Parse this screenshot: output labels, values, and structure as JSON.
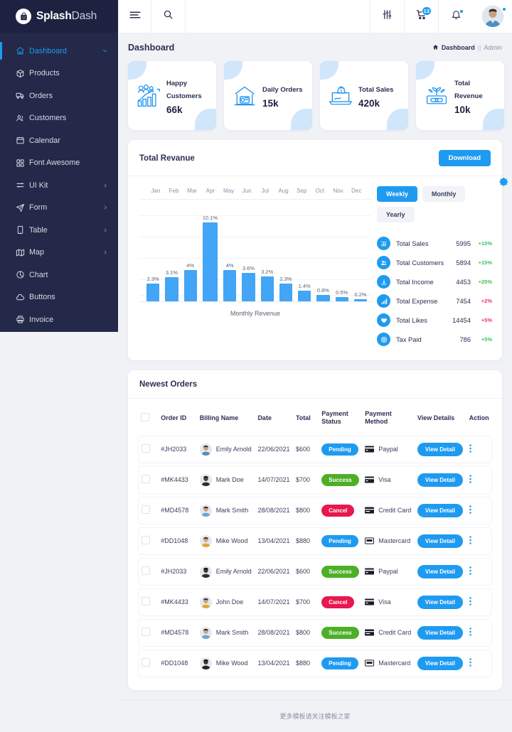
{
  "brand": {
    "part1": "Splash",
    "part2": "Dash",
    "logo_icon": "shopping-bag-icon"
  },
  "sidebar": {
    "items": [
      {
        "label": "Dashboard",
        "icon": "home-icon",
        "active": true,
        "chevron": true
      },
      {
        "label": "Products",
        "icon": "box-icon",
        "active": false,
        "chevron": false
      },
      {
        "label": "Orders",
        "icon": "truck-icon",
        "active": false,
        "chevron": false
      },
      {
        "label": "Customers",
        "icon": "users-icon",
        "active": false,
        "chevron": false
      },
      {
        "label": "Calendar",
        "icon": "calendar-icon",
        "active": false,
        "chevron": false
      },
      {
        "label": "Font Awesome",
        "icon": "grid-icon",
        "active": false,
        "chevron": false
      },
      {
        "label": "UI Kit",
        "icon": "sliders-icon",
        "active": false,
        "chevron": true
      },
      {
        "label": "Form",
        "icon": "send-icon",
        "active": false,
        "chevron": true
      },
      {
        "label": "Table",
        "icon": "tablet-icon",
        "active": false,
        "chevron": true
      },
      {
        "label": "Map",
        "icon": "map-icon",
        "active": false,
        "chevron": true
      },
      {
        "label": "Chart",
        "icon": "pie-chart-icon",
        "active": false,
        "chevron": false
      },
      {
        "label": "Buttons",
        "icon": "cloud-icon",
        "active": false,
        "chevron": false
      },
      {
        "label": "Invoice",
        "icon": "printer-icon",
        "active": false,
        "chevron": false
      }
    ]
  },
  "topbar": {
    "menu_icon": "hamburger-icon",
    "search_icon": "search-icon",
    "filter_icon": "sliders-icon",
    "cart_icon": "cart-icon",
    "cart_badge": "13",
    "bell_icon": "bell-icon",
    "avatar_icon": "user-avatar"
  },
  "page": {
    "title": "Dashboard",
    "breadcrumb": {
      "home_icon": "home-icon",
      "current": "Dashboard",
      "separator": "||",
      "parent": "Admin"
    }
  },
  "stats_cards": [
    {
      "label": "Happy Customers",
      "value": "66k",
      "icon": "customers-growth-icon"
    },
    {
      "label": "Daily Orders",
      "value": "15k",
      "icon": "store-icon"
    },
    {
      "label": "Total Sales",
      "value": "420k",
      "icon": "laptop-sale-icon"
    },
    {
      "label": "Total Revenue",
      "value": "10k",
      "icon": "money-plant-icon"
    }
  ],
  "revenue": {
    "title": "Total Revanue",
    "download_label": "Download",
    "gear_icon": "gear-icon",
    "toggles": [
      {
        "label": "Weekly",
        "active": true
      },
      {
        "label": "Monthly",
        "active": false
      },
      {
        "label": "Yearly",
        "active": false
      }
    ],
    "stats": [
      {
        "icon": "chart-bar-icon",
        "name": "Total Sales",
        "value": "5995",
        "pct": "+15%",
        "dir": "up"
      },
      {
        "icon": "users-icon",
        "name": "Total Customers",
        "value": "5894",
        "pct": "+15%",
        "dir": "up"
      },
      {
        "icon": "download-icon",
        "name": "Total Income",
        "value": "4453",
        "pct": "+25%",
        "dir": "up"
      },
      {
        "icon": "signal-icon",
        "name": "Total Expense",
        "value": "7454",
        "pct": "+2%",
        "dir": "down"
      },
      {
        "icon": "heart-icon",
        "name": "Total Likes",
        "value": "14454",
        "pct": "+5%",
        "dir": "down"
      },
      {
        "icon": "check-circle-icon",
        "name": "Tax Paid",
        "value": "786",
        "pct": "+5%",
        "dir": "up"
      }
    ]
  },
  "chart_data": {
    "type": "bar",
    "title": "Total Revanue",
    "xlabel": "Monthly Revenue",
    "ylabel": "",
    "categories": [
      "Jan",
      "Feb",
      "Mar",
      "Apr",
      "May",
      "Jun",
      "Jul",
      "Aug",
      "Sep",
      "Oct",
      "Nov",
      "Dec"
    ],
    "values": [
      2.3,
      3.1,
      4.0,
      10.1,
      4.0,
      3.6,
      3.2,
      2.3,
      1.4,
      0.8,
      0.5,
      0.2
    ],
    "data_labels": [
      "2.3%",
      "3.1%",
      "4%",
      "10.1%",
      "4%",
      "3.6%",
      "3.2%",
      "2.3%",
      "1.4%",
      "0.8%",
      "0.5%",
      "0.2%"
    ],
    "ylim": [
      0,
      12
    ],
    "grid": true,
    "legend": "none",
    "bar_color": "#42a5f5",
    "axis_tick_labels_position": "top"
  },
  "orders": {
    "title": "Newest Orders",
    "columns": [
      "",
      "Order ID",
      "Billing Name",
      "Date",
      "Total",
      "Payment Status",
      "Payment Method",
      "View Details",
      "Action"
    ],
    "view_label": "View Detail",
    "rows": [
      {
        "order_id": "#JH2033",
        "name": "Emily Arnold",
        "date": "22/06/2021",
        "total": "$600",
        "status": "Pending",
        "status_kind": "pending",
        "method": "Paypal",
        "method_icon": "card-icon"
      },
      {
        "order_id": "#MK4433",
        "name": "Mark Doe",
        "date": "14/07/2021",
        "total": "$700",
        "status": "Success",
        "status_kind": "success",
        "method": "Visa",
        "method_icon": "card-icon"
      },
      {
        "order_id": "#MD4578",
        "name": "Mark Smith",
        "date": "28/08/2021",
        "total": "$800",
        "status": "Cancel",
        "status_kind": "cancel",
        "method": "Credit Card",
        "method_icon": "credit-card-icon"
      },
      {
        "order_id": "#DD1048",
        "name": "Mike Wood",
        "date": "13/04/2021",
        "total": "$880",
        "status": "Pending",
        "status_kind": "pending",
        "method": "Mastercard",
        "method_icon": "mastercard-icon"
      },
      {
        "order_id": "#JH2033",
        "name": "Emily Arnold",
        "date": "22/06/2021",
        "total": "$600",
        "status": "Success",
        "status_kind": "success",
        "method": "Paypal",
        "method_icon": "card-icon"
      },
      {
        "order_id": "#MK4433",
        "name": "John Doe",
        "date": "14/07/2021",
        "total": "$700",
        "status": "Cancel",
        "status_kind": "cancel",
        "method": "Visa",
        "method_icon": "card-icon"
      },
      {
        "order_id": "#MD4578",
        "name": "Mark Smith",
        "date": "28/08/2021",
        "total": "$800",
        "status": "Success",
        "status_kind": "success",
        "method": "Credit Card",
        "method_icon": "credit-card-icon"
      },
      {
        "order_id": "#DD1048",
        "name": "Mike Wood",
        "date": "13/04/2021",
        "total": "$880",
        "status": "Pending",
        "status_kind": "pending",
        "method": "Mastercard",
        "method_icon": "mastercard-icon"
      }
    ]
  },
  "footer": {
    "text": "更多模板请关注模板之家"
  },
  "colors": {
    "accent": "#1e9bf0",
    "sidebar": "#242949",
    "bar": "#42a5f5",
    "success": "#4caf27",
    "cancel": "#e8174e",
    "up": "#34c759",
    "down": "#f0325e",
    "page_bg": "#f1f2f6"
  }
}
